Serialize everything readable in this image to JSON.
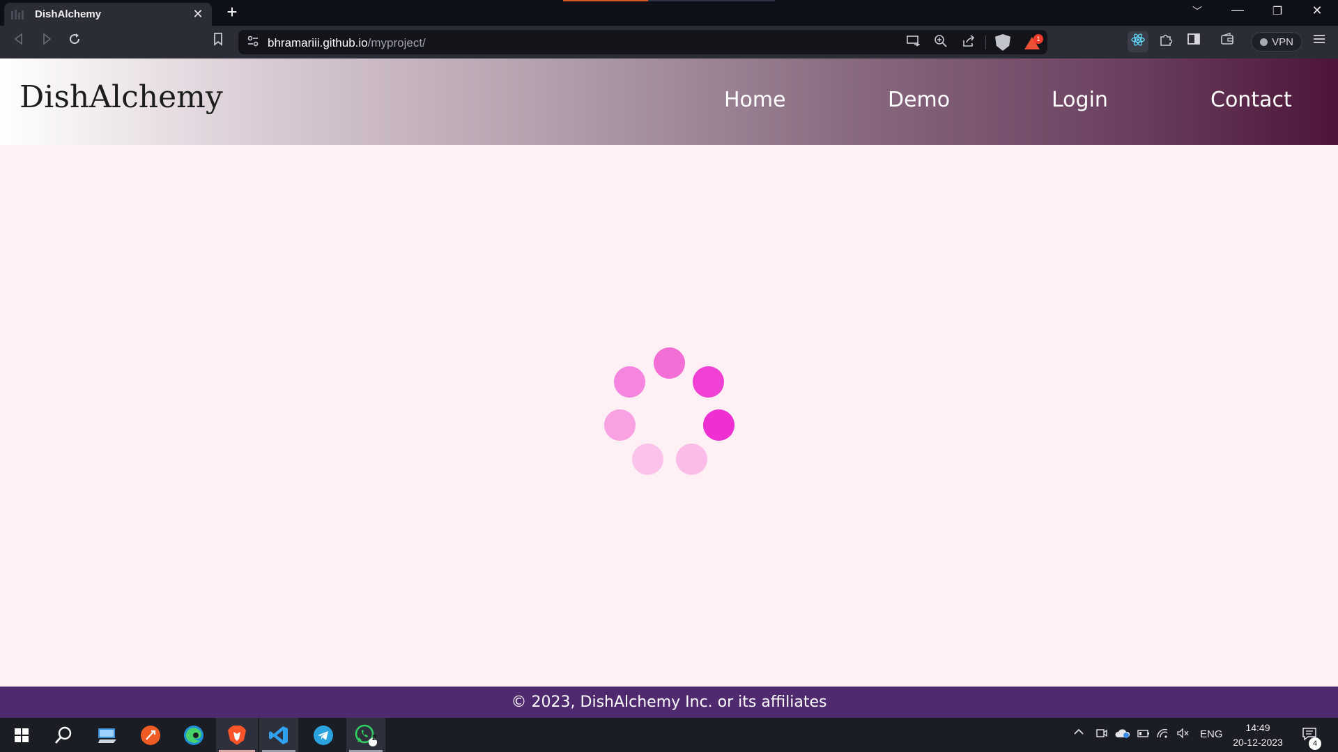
{
  "browser": {
    "tab_title": "DishAlchemy",
    "tab_close_glyph": "✕",
    "new_tab_glyph": "+",
    "url_host": "bhramariii.github.io",
    "url_path": "/myproject/",
    "load_progress_percent": 40,
    "rewards_badge": "1",
    "vpn_label": "VPN",
    "window_controls": [
      "﹀",
      "—",
      "❐",
      "✕"
    ]
  },
  "site": {
    "logo_text": "DishAlchemy",
    "nav": [
      "Home",
      "Demo",
      "Login",
      "Contact"
    ],
    "loader_colors": [
      "#f46fd5",
      "#f041d4",
      "#ee2fd2",
      "#fbbde8",
      "#fbc2ea",
      "#f9a1e2",
      "#f585de"
    ],
    "footer_text": "© 2023, DishAlchemy Inc. or its affiliates"
  },
  "taskbar": {
    "apps": [
      "start",
      "search",
      "file-explorer",
      "postman",
      "edge",
      "brave",
      "vscode",
      "telegram",
      "whatsapp"
    ],
    "whatsapp_badge": "2",
    "language": "ENG",
    "time": "14:49",
    "date": "20-12-2023",
    "notifications_count": "4"
  }
}
